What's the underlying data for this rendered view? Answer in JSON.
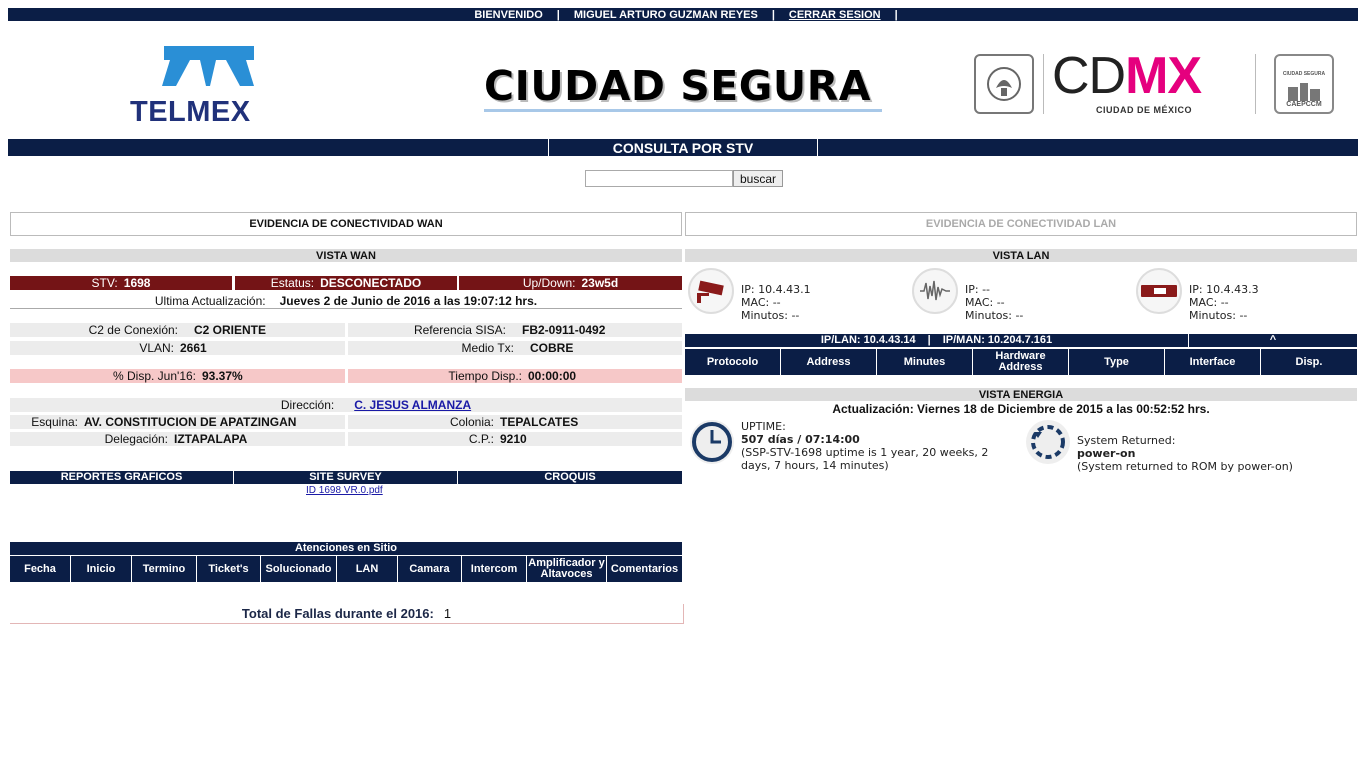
{
  "topbar": {
    "welcome": "BIENVENIDO",
    "user": "MIGUEL ARTURO GUZMAN REYES",
    "logout": "CERRAR SESION"
  },
  "header": {
    "telmex": "TELMEX",
    "ciudad_segura": "CIUDAD SEGURA",
    "cdmx_cd": "CD",
    "cdmx_mx": "MX",
    "cdmx_sub": "CIUDAD DE MÉXICO",
    "caepccm_top": "CIUDAD SEGURA",
    "caepccm": "CAEPCCM"
  },
  "consulta": {
    "title": "CONSULTA POR STV",
    "search_value": "",
    "search_button": "buscar"
  },
  "wan": {
    "evidence_title": "EVIDENCIA DE CONECTIVIDAD WAN",
    "vista_title": "VISTA WAN",
    "stv_label": "STV:",
    "stv_value": "1698",
    "status_label": "Estatus:",
    "status_value": "DESCONECTADO",
    "updown_label": "Up/Down:",
    "updown_value": "23w5d",
    "last_update_label": "Ultima Actualización:",
    "last_update_value": "Jueves 2 de Junio de 2016 a las 19:07:12 hrs.",
    "c2_label": "C2 de Conexión:",
    "c2_value": "C2 ORIENTE",
    "sisa_label": "Referencia SISA:",
    "sisa_value": "FB2-0911-0492",
    "vlan_label": "VLAN:",
    "vlan_value": "2661",
    "medio_label": "Medio Tx:",
    "medio_value": "COBRE",
    "disp_label": "% Disp. Jun'16:",
    "disp_value": "93.37%",
    "tiempo_label": "Tiempo Disp.:",
    "tiempo_value": "00:00:00",
    "direccion_label": "Dirección:",
    "direccion_value": "C. JESUS ALMANZA",
    "esquina_label": "Esquina:",
    "esquina_value": "AV. CONSTITUCION DE APATZINGAN",
    "colonia_label": "Colonia:",
    "colonia_value": "TEPALCATES",
    "delegacion_label": "Delegación:",
    "delegacion_value": "IZTAPALAPA",
    "cp_label": "C.P.:",
    "cp_value": "9210"
  },
  "reports": {
    "tabs": [
      "REPORTES GRAFICOS",
      "SITE SURVEY",
      "CROQUIS"
    ],
    "survey_link": "ID 1698 VR.0.pdf"
  },
  "atenciones": {
    "title": "Atenciones en Sitio",
    "columns": [
      "Fecha",
      "Inicio",
      "Termino",
      "Ticket's",
      "Solucionado",
      "LAN",
      "Camara",
      "Intercom",
      "Amplificador y Altavoces",
      "Comentarios"
    ],
    "total_label": "Total de Fallas durante el 2016:",
    "total_value": "1"
  },
  "lan": {
    "evidence_title": "EVIDENCIA DE CONECTIVIDAD LAN",
    "vista_title": "VISTA LAN",
    "devices": [
      {
        "icon": "camera-icon",
        "ip": "IP: 10.4.43.1",
        "mac": "MAC: --",
        "min": "Minutos: --"
      },
      {
        "icon": "audio-icon",
        "ip": "IP: --",
        "mac": "MAC: --",
        "min": "Minutos: --"
      },
      {
        "icon": "ups-icon",
        "ip": "IP: 10.4.43.3",
        "mac": "MAC: --",
        "min": "Minutos: --"
      }
    ],
    "ip_lan": "IP/LAN: 10.4.43.14",
    "ip_man": "IP/MAN: 10.204.7.161",
    "caret": "^",
    "columns": [
      "Protocolo",
      "Address",
      "Minutes",
      "Hardware Address",
      "Type",
      "Interface",
      "Disp."
    ]
  },
  "energia": {
    "title": "VISTA ENERGIA",
    "update": "Actualización: Viernes 18 de Diciembre de 2015 a las 00:52:52 hrs.",
    "uptime_label": "UPTIME:",
    "uptime_value": "507 días / 07:14:00",
    "uptime_detail": "(SSP-STV-1698 uptime is 1 year, 20 weeks, 2 days, 7 hours, 14 minutes)",
    "returned_label": "System Returned:",
    "returned_value": "power-on",
    "returned_detail": "(System returned to ROM by power-on)"
  },
  "colors": {
    "navy": "#0b1e46",
    "maroon": "#741416",
    "pink": "#f6c8c8",
    "cdmx_magenta": "#e5007e"
  }
}
